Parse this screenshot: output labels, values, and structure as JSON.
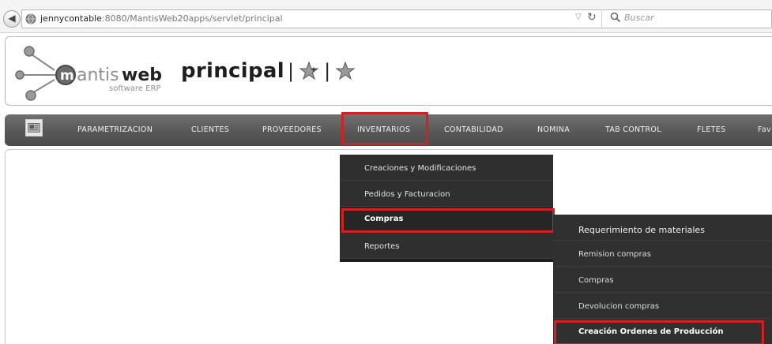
{
  "browser": {
    "url_host": "jennycontable",
    "url_rest": ":8080/MantisWeb20apps/servlet/principal",
    "search_placeholder": "Buscar"
  },
  "header": {
    "logo_text": "mantisweb",
    "logo_subtext": "software ERP",
    "title": "principal"
  },
  "menu": {
    "items": [
      {
        "label": "PARAMETRIZACION"
      },
      {
        "label": "CLIENTES"
      },
      {
        "label": "PROVEEDORES"
      },
      {
        "label": "INVENTARIOS"
      },
      {
        "label": "CONTABILIDAD"
      },
      {
        "label": "NOMINA"
      },
      {
        "label": "TAB CONTROL"
      },
      {
        "label": "FLETES"
      },
      {
        "label": "Fav"
      }
    ]
  },
  "dropdown": {
    "items": [
      {
        "label": "Creaciones y Modificaciones"
      },
      {
        "label": "Pedidos y Facturacion"
      },
      {
        "label": "Compras"
      },
      {
        "label": "Reportes"
      }
    ]
  },
  "submenu": {
    "items": [
      {
        "label": "Requerimiento de materiales"
      },
      {
        "label": "Remision compras"
      },
      {
        "label": "Compras"
      },
      {
        "label": "Devolucion compras"
      },
      {
        "label": "Creación Ordenes de Producción"
      }
    ]
  },
  "colors": {
    "highlight": "#d42020",
    "menubar": "#5a5a5a",
    "dropdown_bg": "#2f2f2f"
  }
}
